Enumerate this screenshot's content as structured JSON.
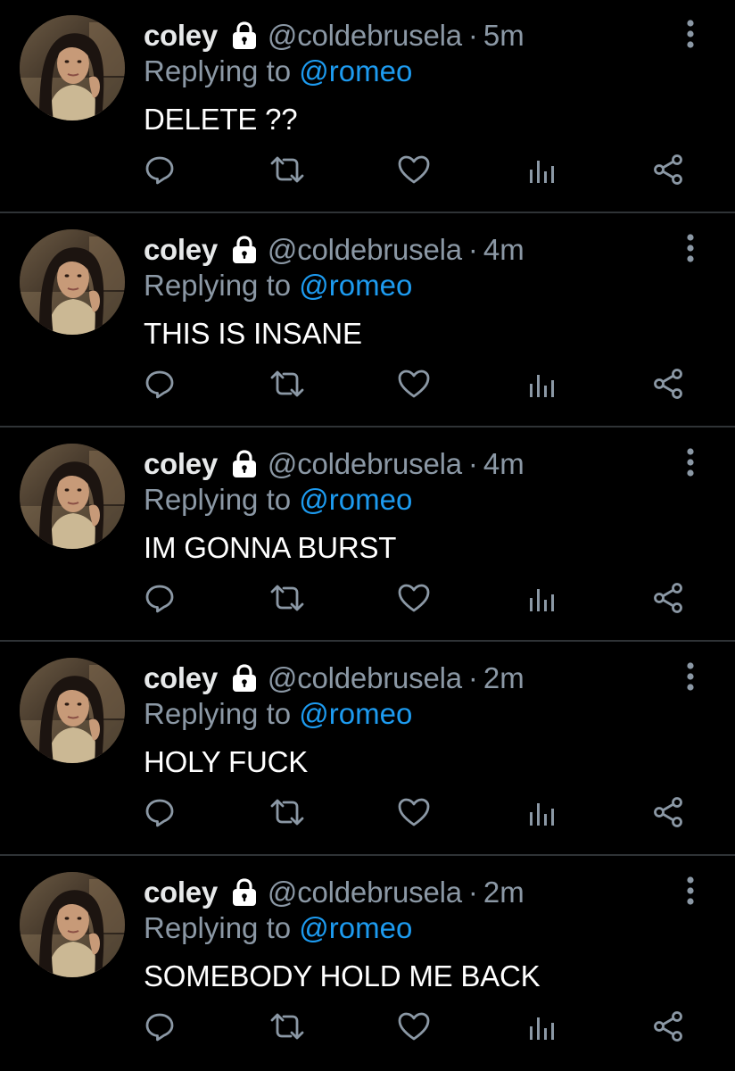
{
  "colors": {
    "background": "#000000",
    "divider": "#2f3336",
    "primary_text": "#ffffff",
    "secondary_text": "#8b98a5",
    "accent": "#1d9bf0"
  },
  "icons": {
    "lock": "lock-icon",
    "more": "more-vertical-icon",
    "reply": "reply-icon",
    "retweet": "retweet-icon",
    "like": "heart-icon",
    "views": "views-bar-chart-icon",
    "share": "share-icon"
  },
  "tweets": [
    {
      "display_name": "coley",
      "handle": "@coldebrusela",
      "separator": "·",
      "time": "5m",
      "replying_prefix": "Replying to",
      "replying_to": "@romeo",
      "text": "DELETE ??"
    },
    {
      "display_name": "coley",
      "handle": "@coldebrusela",
      "separator": "·",
      "time": "4m",
      "replying_prefix": "Replying to",
      "replying_to": "@romeo",
      "text": "THIS IS INSANE"
    },
    {
      "display_name": "coley",
      "handle": "@coldebrusela",
      "separator": "·",
      "time": "4m",
      "replying_prefix": "Replying to",
      "replying_to": "@romeo",
      "text": "IM GONNA BURST"
    },
    {
      "display_name": "coley",
      "handle": "@coldebrusela",
      "separator": "·",
      "time": "2m",
      "replying_prefix": "Replying to",
      "replying_to": "@romeo",
      "text": "HOLY FUCK"
    },
    {
      "display_name": "coley",
      "handle": "@coldebrusela",
      "separator": "·",
      "time": "2m",
      "replying_prefix": "Replying to",
      "replying_to": "@romeo",
      "text": "SOMEBODY HOLD ME BACK"
    }
  ]
}
